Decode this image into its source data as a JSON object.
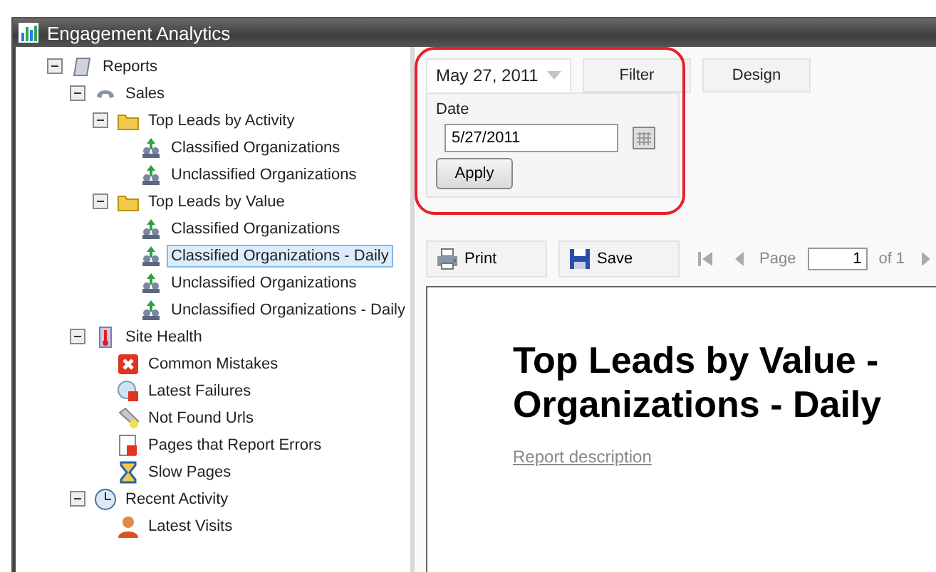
{
  "window": {
    "title": "Engagement Analytics"
  },
  "tree": [
    {
      "label": "Reports",
      "kind": "scroll",
      "expanded": true,
      "selected": false,
      "children": [
        {
          "label": "Sales",
          "kind": "phone",
          "expanded": true,
          "selected": false,
          "children": [
            {
              "label": "Top Leads by Activity",
              "kind": "folder",
              "expanded": true,
              "selected": false,
              "children": [
                {
                  "label": "Classified Organizations",
                  "kind": "people",
                  "selected": false
                },
                {
                  "label": "Unclassified Organizations",
                  "kind": "people",
                  "selected": false
                }
              ]
            },
            {
              "label": "Top Leads by Value",
              "kind": "folder",
              "expanded": true,
              "selected": false,
              "children": [
                {
                  "label": "Classified Organizations",
                  "kind": "people",
                  "selected": false
                },
                {
                  "label": "Classified Organizations - Daily",
                  "kind": "people",
                  "selected": true
                },
                {
                  "label": "Unclassified Organizations",
                  "kind": "people",
                  "selected": false
                },
                {
                  "label": "Unclassified Organizations - Daily",
                  "kind": "people",
                  "selected": false
                }
              ]
            }
          ]
        },
        {
          "label": "Site Health",
          "kind": "thermometer",
          "expanded": true,
          "selected": false,
          "children": [
            {
              "label": "Common Mistakes",
              "kind": "error",
              "selected": false
            },
            {
              "label": "Latest Failures",
              "kind": "failure",
              "selected": false
            },
            {
              "label": "Not Found Urls",
              "kind": "flashlight",
              "selected": false
            },
            {
              "label": "Pages that Report Errors",
              "kind": "page-error",
              "selected": false
            },
            {
              "label": "Slow Pages",
              "kind": "hourglass",
              "selected": false
            }
          ]
        },
        {
          "label": "Recent Activity",
          "kind": "clock",
          "expanded": true,
          "selected": false,
          "children": [
            {
              "label": "Latest Visits",
              "kind": "person",
              "selected": false
            }
          ]
        }
      ]
    }
  ],
  "tabs": [
    {
      "label": "May 27, 2011",
      "kind": "dropdown",
      "selected": true
    },
    {
      "label": "Filter",
      "kind": "plain",
      "selected": false
    },
    {
      "label": "Design",
      "kind": "plain",
      "selected": false
    }
  ],
  "filter": {
    "label": "Date",
    "value": "5/27/2011",
    "button": "Apply"
  },
  "toolbar": {
    "print": "Print",
    "save": "Save",
    "page_label": "Page",
    "page": "1",
    "of": "of 1"
  },
  "report": {
    "heading_lines": [
      "Top Leads by Value -",
      "Organizations - Daily"
    ],
    "link": "Report description"
  }
}
